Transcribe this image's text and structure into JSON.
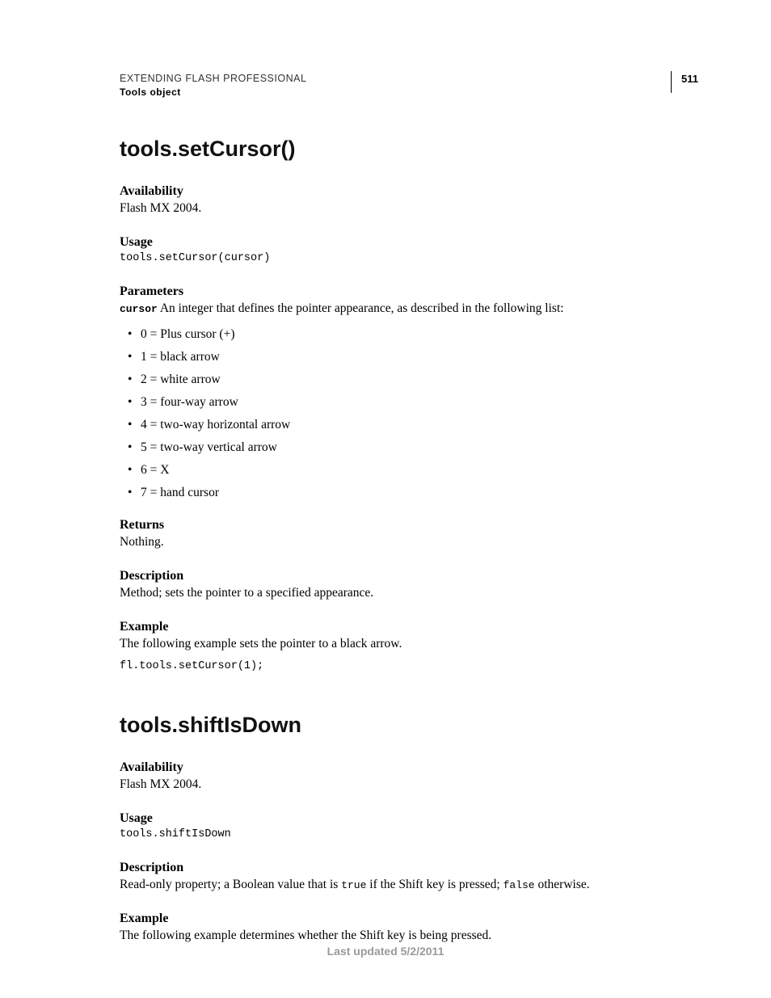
{
  "header": {
    "title": "EXTENDING FLASH PROFESSIONAL",
    "subtitle": "Tools object",
    "pageNumber": "511"
  },
  "s1": {
    "heading": "tools.setCursor()",
    "availability_label": "Availability",
    "availability_text": "Flash MX 2004.",
    "usage_label": "Usage",
    "usage_code": "tools.setCursor(cursor)",
    "parameters_label": "Parameters",
    "param_name": "cursor",
    "param_desc": "An integer that defines the pointer appearance, as described in the following list:",
    "list": [
      "0 = Plus cursor (+)",
      "1 = black arrow",
      "2 = white arrow",
      "3 = four-way arrow",
      "4 = two-way horizontal arrow",
      "5 = two-way vertical arrow",
      "6 = X",
      "7 = hand cursor"
    ],
    "returns_label": "Returns",
    "returns_text": "Nothing.",
    "description_label": "Description",
    "description_text": "Method; sets the pointer to a specified appearance.",
    "example_label": "Example",
    "example_text": "The following example sets the pointer to a black arrow.",
    "example_code": "fl.tools.setCursor(1);"
  },
  "s2": {
    "heading": "tools.shiftIsDown",
    "availability_label": "Availability",
    "availability_text": "Flash MX 2004.",
    "usage_label": "Usage",
    "usage_code": "tools.shiftIsDown",
    "description_label": "Description",
    "desc_p1": "Read-only property; a Boolean value that is ",
    "desc_c1": "true",
    "desc_p2": " if the Shift key is pressed; ",
    "desc_c2": "false",
    "desc_p3": " otherwise.",
    "example_label": "Example",
    "example_text": "The following example determines whether the Shift key is being pressed."
  },
  "footer": "Last updated 5/2/2011"
}
